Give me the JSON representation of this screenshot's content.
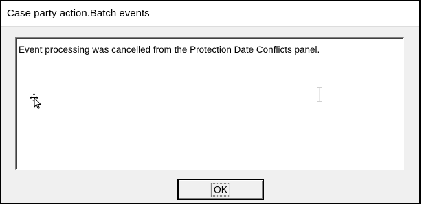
{
  "window": {
    "title": "Case party action.Batch events"
  },
  "message": {
    "text": "Event processing was cancelled from the Protection Date Conflicts panel."
  },
  "buttons": {
    "ok_label": "OK"
  },
  "icons": {
    "move_cursor": "move-cursor-icon",
    "text_cursor": "ibeam-cursor-icon"
  }
}
